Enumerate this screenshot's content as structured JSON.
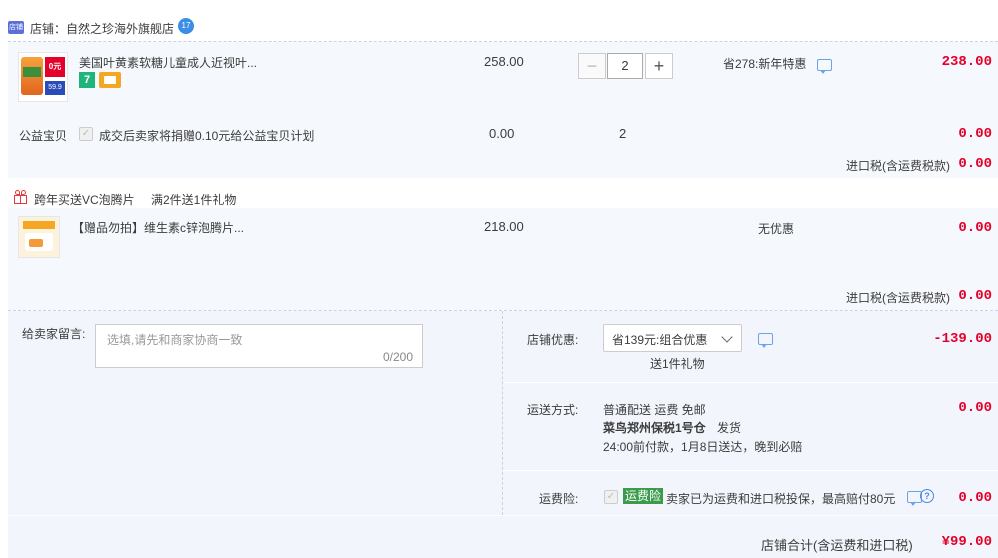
{
  "shop": {
    "label": "店铺：自然之珍海外旗舰店",
    "badge": "17"
  },
  "item1": {
    "name": "美国叶黄素软糖儿童成人近视叶...",
    "price": "258.00",
    "qty": "2",
    "minus": "−",
    "plus": "+",
    "promo": "省278:新年特惠",
    "total": "238.00",
    "tag_badge": "7",
    "thumb_price": "0元",
    "thumb_sub": "59.9"
  },
  "charity": {
    "label": "公益宝贝",
    "desc": "成交后卖家将捐赠0.10元给公益宝贝计划",
    "price": "0.00",
    "qty": "2",
    "total": "0.00"
  },
  "tax1": {
    "label": "进口税(含运费税款)",
    "value": "0.00"
  },
  "gift": {
    "title": "跨年买送VC泡腾片",
    "rule": "满2件送1件礼物",
    "name": "【赠品勿拍】维生素c锌泡腾片...",
    "price": "218.00",
    "promo": "无优惠",
    "total": "0.00"
  },
  "tax2": {
    "label": "进口税(含运费税款)",
    "value": "0.00"
  },
  "message": {
    "label": "给卖家留言:",
    "placeholder": "选填,请先和商家协商一致",
    "counter": "0/200"
  },
  "discount": {
    "label": "店铺优惠:",
    "selected": "省139元:组合优惠",
    "gift_note": "送1件礼物",
    "value": "-139.00"
  },
  "shipping": {
    "label": "运送方式:",
    "method": "普通配送 运费 免邮",
    "warehouse": "菜鸟郑州保税1号仓",
    "send": "发货",
    "eta": "24:00前付款，1月8日送达，晚到必赔",
    "value": "0.00"
  },
  "insurance": {
    "label": "运费险:",
    "tag": "运费险",
    "desc": "卖家已为运费和进口税投保，最高赔付80元",
    "help": "?",
    "value": "0.00"
  },
  "summary": {
    "label": "店铺合计(含运费和进口税)",
    "value": "¥99.00"
  },
  "colors": {
    "accent_red": "#e4002b",
    "panel_bg": "#f5f8fd",
    "insurance_green": "#3a9b4b"
  }
}
